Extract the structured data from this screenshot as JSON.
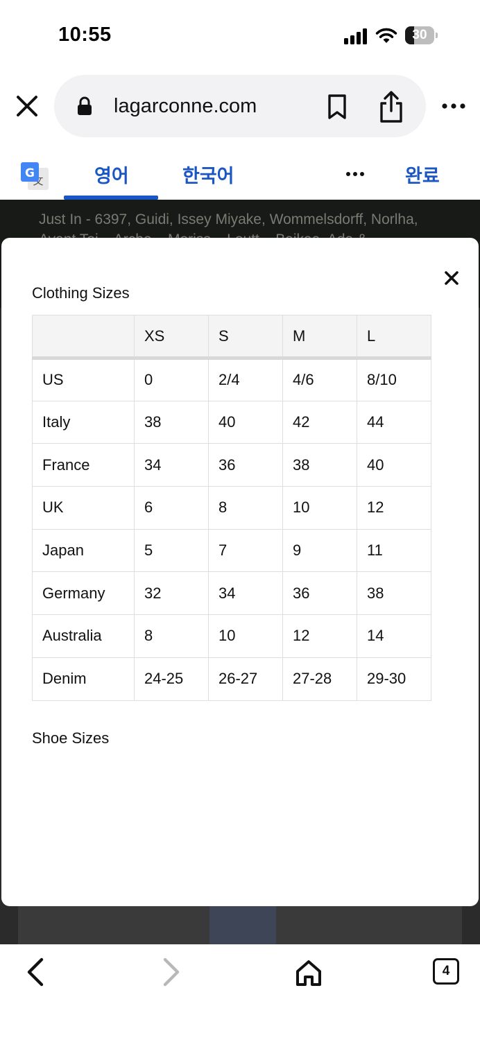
{
  "status_bar": {
    "time": "10:55",
    "battery_level": "30"
  },
  "browser": {
    "url": "lagarconne.com",
    "icons": [
      "close-icon",
      "lock-icon",
      "bookmark-icon",
      "share-icon",
      "more-icon"
    ]
  },
  "translate_bar": {
    "tab_source": "영어",
    "tab_target": "한국어",
    "done_label": "완료",
    "active_tab": "영어"
  },
  "page": {
    "banner_text": "Just In - 6397, Guidi, Issey Miyake, Wommelsdorff, Norlha,",
    "banner_text_2": "Avant Toi... Arche... Moriss... Loutt... Baikaa, Ada &"
  },
  "modal": {
    "clothing_title": "Clothing Sizes",
    "shoe_title": "Shoe Sizes",
    "table": {
      "headers": [
        "",
        "XS",
        "S",
        "M",
        "L"
      ],
      "rows": [
        [
          "US",
          "0",
          "2/4",
          "4/6",
          "8/10"
        ],
        [
          "Italy",
          "38",
          "40",
          "42",
          "44"
        ],
        [
          "France",
          "34",
          "36",
          "38",
          "40"
        ],
        [
          "UK",
          "6",
          "8",
          "10",
          "12"
        ],
        [
          "Japan",
          "5",
          "7",
          "9",
          "11"
        ],
        [
          "Germany",
          "32",
          "34",
          "36",
          "38"
        ],
        [
          "Australia",
          "8",
          "10",
          "12",
          "14"
        ],
        [
          "Denim",
          "24-25",
          "26-27",
          "27-28",
          "29-30"
        ]
      ]
    }
  },
  "toolbar": {
    "tab_count": "4"
  },
  "colors": {
    "accent": "#1a56c4",
    "banner": "#171a16",
    "table_header_bg": "#f4f4f4"
  }
}
